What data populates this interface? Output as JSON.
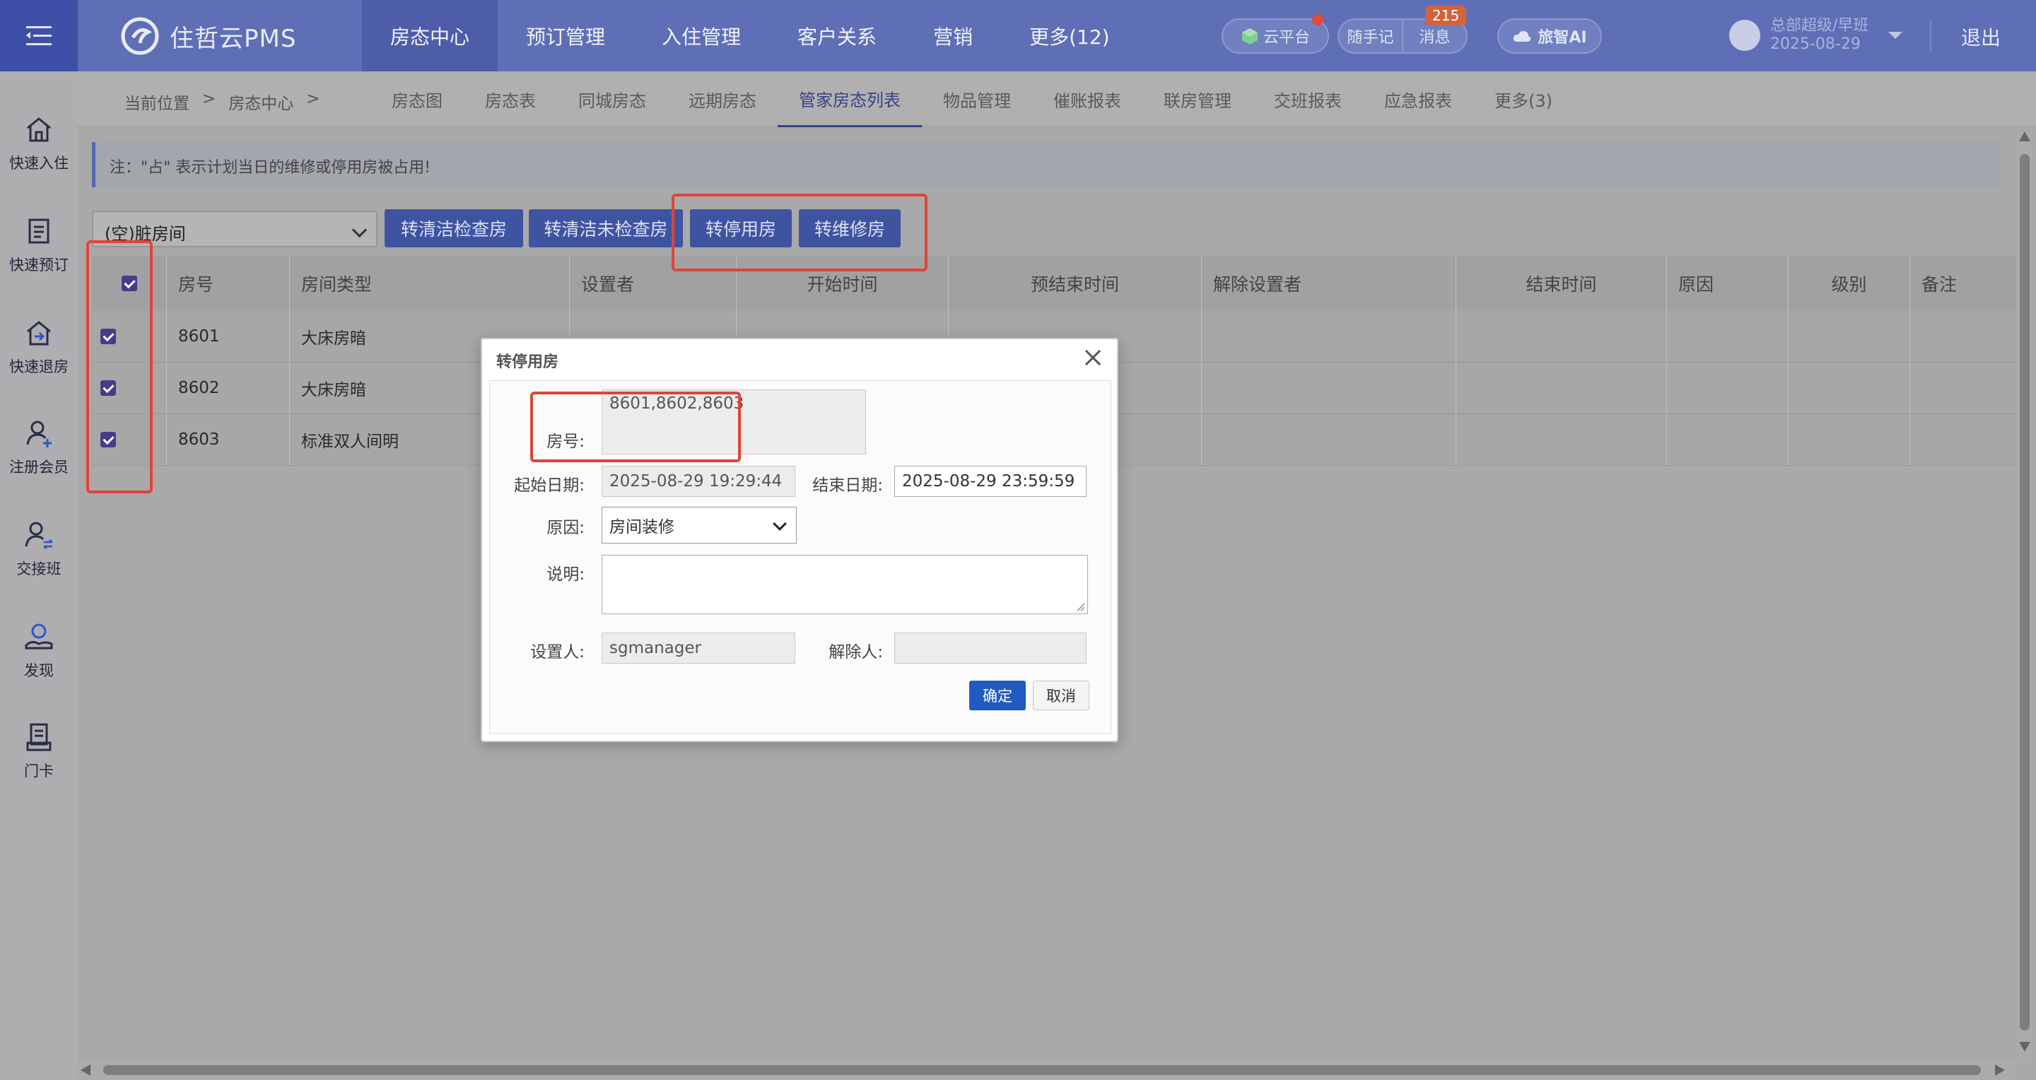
{
  "app": {
    "logo_text": "住哲云PMS",
    "nav": [
      "房态中心",
      "预订管理",
      "入住管理",
      "客户关系",
      "营销",
      "更多(12)"
    ],
    "cloud_label": "云平台",
    "notes_label": "随手记",
    "messages_label": "消息",
    "messages_count": "215",
    "ai_label": "旅智AI",
    "user_name": "总部超级/早班",
    "user_date": "2025-08-29",
    "logout_label": "退出"
  },
  "sidebar": [
    {
      "label": "快速入住",
      "icon": "home-icon"
    },
    {
      "label": "快速预订",
      "icon": "document-icon"
    },
    {
      "label": "快速退房",
      "icon": "checkout-icon"
    },
    {
      "label": "注册会员",
      "icon": "add-user-icon"
    },
    {
      "label": "交接班",
      "icon": "handover-icon"
    },
    {
      "label": "发现",
      "icon": "discover-icon"
    },
    {
      "label": "门卡",
      "icon": "card-icon"
    }
  ],
  "breadcrumb": {
    "label": "当前位置",
    "sep1": ">",
    "section": "房态中心",
    "sep2": ">"
  },
  "subtabs": [
    "房态图",
    "房态表",
    "同城房态",
    "远期房态",
    "管家房态列表",
    "物品管理",
    "催账报表",
    "联房管理",
    "交班报表",
    "应急报表",
    "更多(3)"
  ],
  "notice": "注：\"占\" 表示计划当日的维修或停用房被占用!",
  "filter_value": "(空)脏房间",
  "actions": [
    "转清洁检查房",
    "转清洁未检查房",
    "转停用房",
    "转维修房"
  ],
  "table": {
    "headers": [
      "房号",
      "房间类型",
      "设置者",
      "开始时间",
      "预结束时间",
      "解除设置者",
      "结束时间",
      "原因",
      "级别",
      "备注"
    ],
    "rows": [
      {
        "room": "8601",
        "type": "大床房暗"
      },
      {
        "room": "8602",
        "type": "大床房暗"
      },
      {
        "room": "8603",
        "type": "标准双人间明"
      }
    ]
  },
  "dialog": {
    "title": "转停用房",
    "room_label": "房号:",
    "room_value": "8601,8602,8603",
    "start_label": "起始日期:",
    "start_value": "2025-08-29 19:29:44",
    "end_label": "结束日期:",
    "end_value": "2025-08-29 23:59:59",
    "reason_label": "原因:",
    "reason_value": "房间装修",
    "desc_label": "说明:",
    "desc_value": "",
    "setter_label": "设置人:",
    "setter_value": "sgmanager",
    "releaser_label": "解除人:",
    "releaser_value": "",
    "ok_label": "确定",
    "cancel_label": "取消"
  }
}
